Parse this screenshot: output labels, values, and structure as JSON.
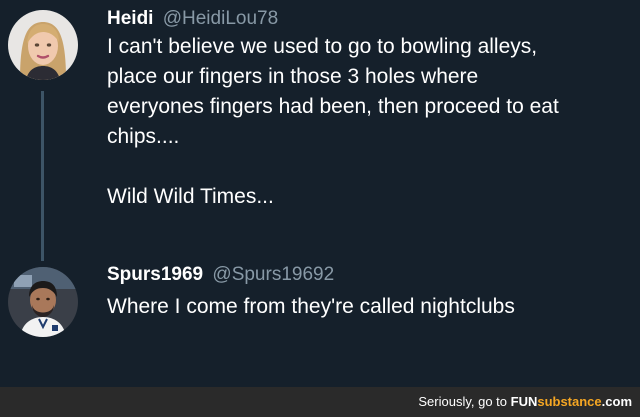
{
  "tweets": [
    {
      "display_name": "Heidi",
      "handle": "@HeidiLou78",
      "avatar": "woman-portrait",
      "text": "I can't believe we used to go to bowling alleys,\nplace our fingers in those 3 holes where\neveryones fingers had been, then proceed to eat\nchips....\n\nWild Wild Times..."
    },
    {
      "display_name": "Spurs1969",
      "handle": "@Spurs19692",
      "avatar": "man-portrait",
      "text": "Where I come from they're called nightclubs"
    }
  ],
  "watermark": {
    "prefix": "Seriously, go to ",
    "brand_fun": "FUN",
    "brand_substance": "substance",
    "brand_suffix": ".com"
  },
  "colors": {
    "background": "#15202b",
    "handle": "#8899a6",
    "thread_line": "#3d5466",
    "watermark_accent": "#f5a623"
  }
}
